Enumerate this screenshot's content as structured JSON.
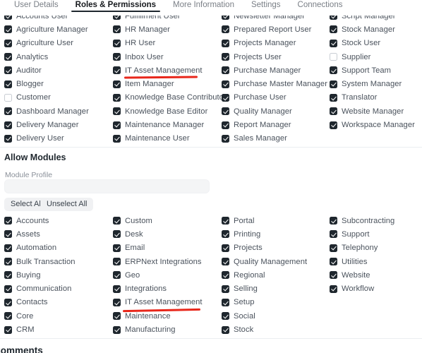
{
  "tabs": [
    {
      "label": "User Details",
      "active": false
    },
    {
      "label": "Roles & Permissions",
      "active": true
    },
    {
      "label": "More Information",
      "active": false
    },
    {
      "label": "Settings",
      "active": false
    },
    {
      "label": "Connections",
      "active": false
    }
  ],
  "roles_section": {
    "columns": [
      [
        {
          "label": "Accounts User",
          "checked": true
        },
        {
          "label": "Agriculture Manager",
          "checked": true
        },
        {
          "label": "Agriculture User",
          "checked": true
        },
        {
          "label": "Analytics",
          "checked": true
        },
        {
          "label": "Auditor",
          "checked": true
        },
        {
          "label": "Blogger",
          "checked": true
        },
        {
          "label": "Customer",
          "checked": false
        },
        {
          "label": "Dashboard Manager",
          "checked": true
        },
        {
          "label": "Delivery Manager",
          "checked": true
        },
        {
          "label": "Delivery User",
          "checked": true
        }
      ],
      [
        {
          "label": "Fulfillment User",
          "checked": true
        },
        {
          "label": "HR Manager",
          "checked": true
        },
        {
          "label": "HR User",
          "checked": true
        },
        {
          "label": "Inbox User",
          "checked": true
        },
        {
          "label": "IT Asset Management",
          "checked": true,
          "annotated": true
        },
        {
          "label": "Item Manager",
          "checked": true
        },
        {
          "label": "Knowledge Base Contributor",
          "checked": true
        },
        {
          "label": "Knowledge Base Editor",
          "checked": true
        },
        {
          "label": "Maintenance Manager",
          "checked": true
        },
        {
          "label": "Maintenance User",
          "checked": true
        }
      ],
      [
        {
          "label": "Newsletter Manager",
          "checked": true
        },
        {
          "label": "Prepared Report User",
          "checked": true
        },
        {
          "label": "Projects Manager",
          "checked": true
        },
        {
          "label": "Projects User",
          "checked": true
        },
        {
          "label": "Purchase Manager",
          "checked": true
        },
        {
          "label": "Purchase Master Manager",
          "checked": true
        },
        {
          "label": "Purchase User",
          "checked": true
        },
        {
          "label": "Quality Manager",
          "checked": true
        },
        {
          "label": "Report Manager",
          "checked": true
        },
        {
          "label": "Sales Manager",
          "checked": true
        }
      ],
      [
        {
          "label": "Script Manager",
          "checked": true
        },
        {
          "label": "Stock Manager",
          "checked": true
        },
        {
          "label": "Stock User",
          "checked": true
        },
        {
          "label": "Supplier",
          "checked": false
        },
        {
          "label": "Support Team",
          "checked": true
        },
        {
          "label": "System Manager",
          "checked": true
        },
        {
          "label": "Translator",
          "checked": true
        },
        {
          "label": "Website Manager",
          "checked": true
        },
        {
          "label": "Workspace Manager",
          "checked": true
        }
      ]
    ]
  },
  "modules_section": {
    "title": "Allow Modules",
    "module_profile_label": "Module Profile",
    "module_profile_value": "",
    "module_profile_placeholder": "",
    "select_all_label": "Select All",
    "unselect_all_label": "Unselect All",
    "columns": [
      [
        {
          "label": "Accounts",
          "checked": true
        },
        {
          "label": "Assets",
          "checked": true
        },
        {
          "label": "Automation",
          "checked": true
        },
        {
          "label": "Bulk Transaction",
          "checked": true
        },
        {
          "label": "Buying",
          "checked": true
        },
        {
          "label": "Communication",
          "checked": true
        },
        {
          "label": "Contacts",
          "checked": true
        },
        {
          "label": "Core",
          "checked": true
        },
        {
          "label": "CRM",
          "checked": true
        }
      ],
      [
        {
          "label": "Custom",
          "checked": true
        },
        {
          "label": "Desk",
          "checked": true
        },
        {
          "label": "Email",
          "checked": true
        },
        {
          "label": "ERPNext Integrations",
          "checked": true
        },
        {
          "label": "Geo",
          "checked": true
        },
        {
          "label": "Integrations",
          "checked": true
        },
        {
          "label": "IT Asset Management",
          "checked": true,
          "annotated": true
        },
        {
          "label": "Maintenance",
          "checked": true
        },
        {
          "label": "Manufacturing",
          "checked": true
        }
      ],
      [
        {
          "label": "Portal",
          "checked": true
        },
        {
          "label": "Printing",
          "checked": true
        },
        {
          "label": "Projects",
          "checked": true
        },
        {
          "label": "Quality Management",
          "checked": true
        },
        {
          "label": "Regional",
          "checked": true
        },
        {
          "label": "Selling",
          "checked": true
        },
        {
          "label": "Setup",
          "checked": true
        },
        {
          "label": "Social",
          "checked": true
        },
        {
          "label": "Stock",
          "checked": true
        }
      ],
      [
        {
          "label": "Subcontracting",
          "checked": true
        },
        {
          "label": "Support",
          "checked": true
        },
        {
          "label": "Telephony",
          "checked": true
        },
        {
          "label": "Utilities",
          "checked": true
        },
        {
          "label": "Website",
          "checked": true
        },
        {
          "label": "Workflow",
          "checked": true
        }
      ]
    ]
  },
  "footer": {
    "comments_title": "Comments"
  },
  "colors": {
    "checkbox_on": "#1f272e",
    "annotation_red": "#e8271b",
    "text_primary": "#1f272e",
    "text_secondary": "#4a525c",
    "muted": "#8a9099"
  }
}
